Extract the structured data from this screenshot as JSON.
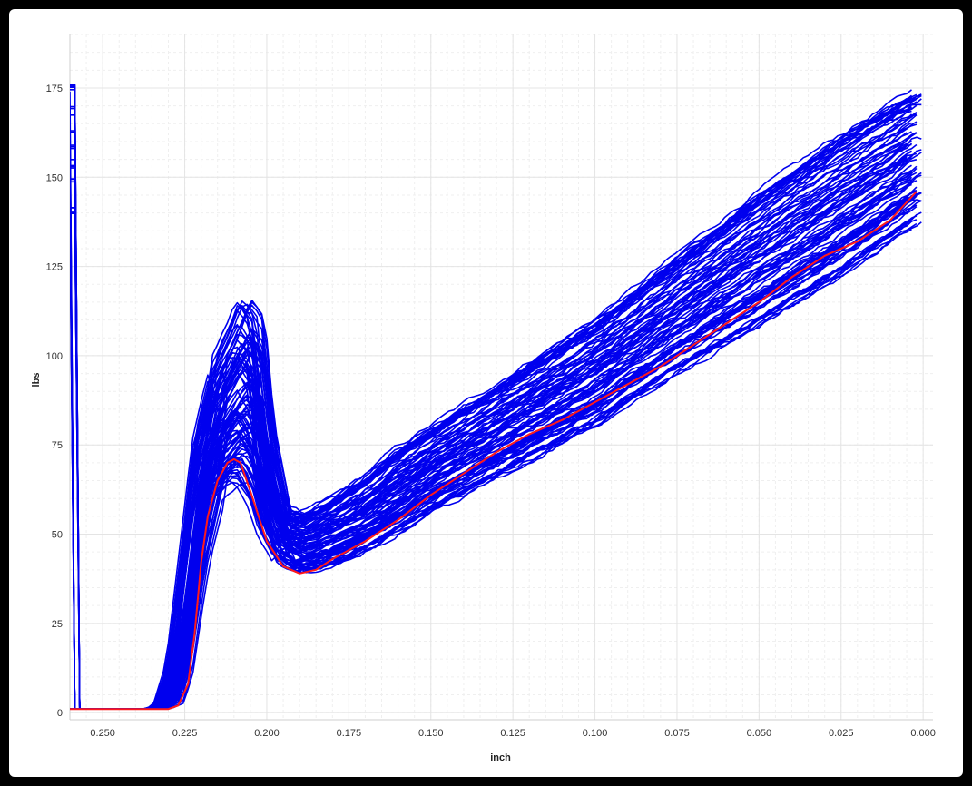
{
  "colors": {
    "background": "#000000",
    "panel": "#ffffff",
    "series_primary": "#0000ee",
    "series_highlight": "#ff1a1a",
    "grid_major": "#e4e4e4",
    "grid_minor": "#efefef"
  },
  "chart_data": {
    "type": "line",
    "title": "",
    "xlabel": "inch",
    "ylabel": "lbs",
    "x_reversed": true,
    "xlim": [
      0.26,
      -0.003
    ],
    "ylim": [
      -2,
      190
    ],
    "x_ticks": [
      0.25,
      0.225,
      0.2,
      0.175,
      0.15,
      0.125,
      0.1,
      0.075,
      0.05,
      0.025,
      0.0
    ],
    "x_tick_labels": [
      "0.250",
      "0.225",
      "0.200",
      "0.175",
      "0.150",
      "0.125",
      "0.100",
      "0.075",
      "0.050",
      "0.025",
      "0.000"
    ],
    "y_ticks": [
      0,
      25,
      50,
      75,
      100,
      125,
      150,
      175
    ],
    "y_tick_labels": [
      "0",
      "25",
      "50",
      "75",
      "100",
      "125",
      "150",
      "175"
    ],
    "grid": true,
    "legend": "none",
    "series_count": 100,
    "series_band": {
      "x": [
        0.26,
        0.235,
        0.232,
        0.228,
        0.225,
        0.22,
        0.215,
        0.21,
        0.207,
        0.203,
        0.2,
        0.195,
        0.19,
        0.18,
        0.17,
        0.16,
        0.15,
        0.125,
        0.1,
        0.075,
        0.05,
        0.025,
        0.0
      ],
      "low": [
        1,
        1,
        1,
        2,
        10,
        40,
        60,
        65,
        65,
        58,
        50,
        42,
        39,
        41,
        45,
        50,
        56,
        68,
        80,
        95,
        108,
        122,
        138
      ],
      "high": [
        1,
        1,
        2,
        15,
        40,
        80,
        98,
        108,
        115,
        110,
        80,
        57,
        55,
        60,
        66,
        74,
        80,
        95,
        110,
        128,
        146,
        162,
        176
      ]
    },
    "series": [
      {
        "name": "",
        "color": "#ff1a1a",
        "x": [
          0.26,
          0.23,
          0.227,
          0.224,
          0.222,
          0.22,
          0.218,
          0.215,
          0.212,
          0.21,
          0.208,
          0.205,
          0.2,
          0.195,
          0.19,
          0.185,
          0.18,
          0.17,
          0.16,
          0.15,
          0.14,
          0.13,
          0.12,
          0.11,
          0.1,
          0.09,
          0.08,
          0.07,
          0.06,
          0.05,
          0.04,
          0.03,
          0.02,
          0.01,
          0.002
        ],
        "y": [
          1,
          1,
          2,
          8,
          22,
          42,
          55,
          65,
          70,
          71,
          70,
          62,
          48,
          41,
          39,
          40,
          43,
          48,
          54,
          61,
          67,
          73,
          78,
          82,
          87,
          92,
          97,
          103,
          109,
          115,
          122,
          128,
          132,
          138,
          146
        ]
      }
    ]
  }
}
